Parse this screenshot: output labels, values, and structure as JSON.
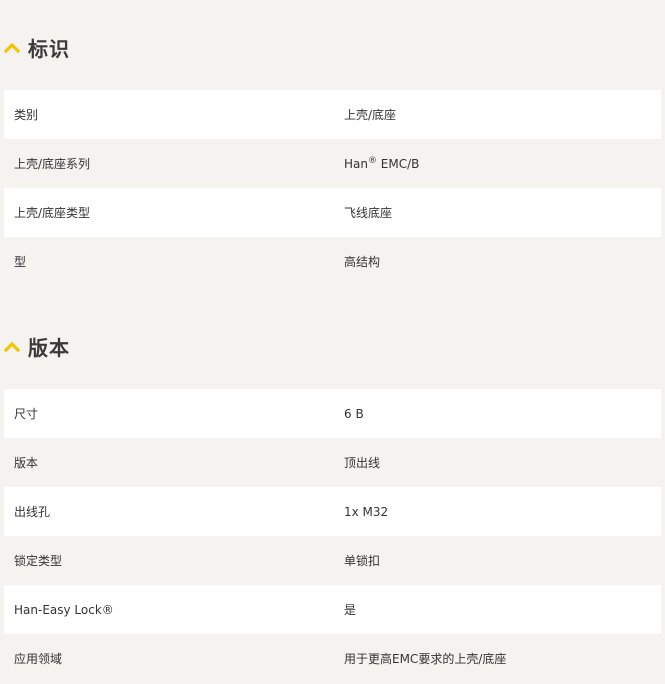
{
  "sections": [
    {
      "title": "标识",
      "rows": [
        {
          "label": "类别",
          "value": "上壳/底座"
        },
        {
          "label": "上壳/底座系列",
          "value_main": "Han",
          "value_sup": "®",
          "value_tail": " EMC/B"
        },
        {
          "label": "上壳/底座类型",
          "value": "飞线底座"
        },
        {
          "label": "型",
          "value": "高结构"
        }
      ]
    },
    {
      "title": "版本",
      "rows": [
        {
          "label": "尺寸",
          "value": "6 B"
        },
        {
          "label": "版本",
          "value": "顶出线"
        },
        {
          "label": "出线孔",
          "value": "1x M32"
        },
        {
          "label": "锁定类型",
          "value": "单锁扣"
        },
        {
          "label": "Han-Easy Lock®",
          "value": "是"
        },
        {
          "label": "应用领域",
          "value": "用于更高EMC要求的上壳/底座"
        }
      ]
    }
  ],
  "colors": {
    "accent": "#f5c400",
    "row_white": "#ffffff",
    "row_grey": "#f4f3f0",
    "text": "#333333"
  },
  "icons": {
    "section_toggle": "chevron-up-icon"
  }
}
